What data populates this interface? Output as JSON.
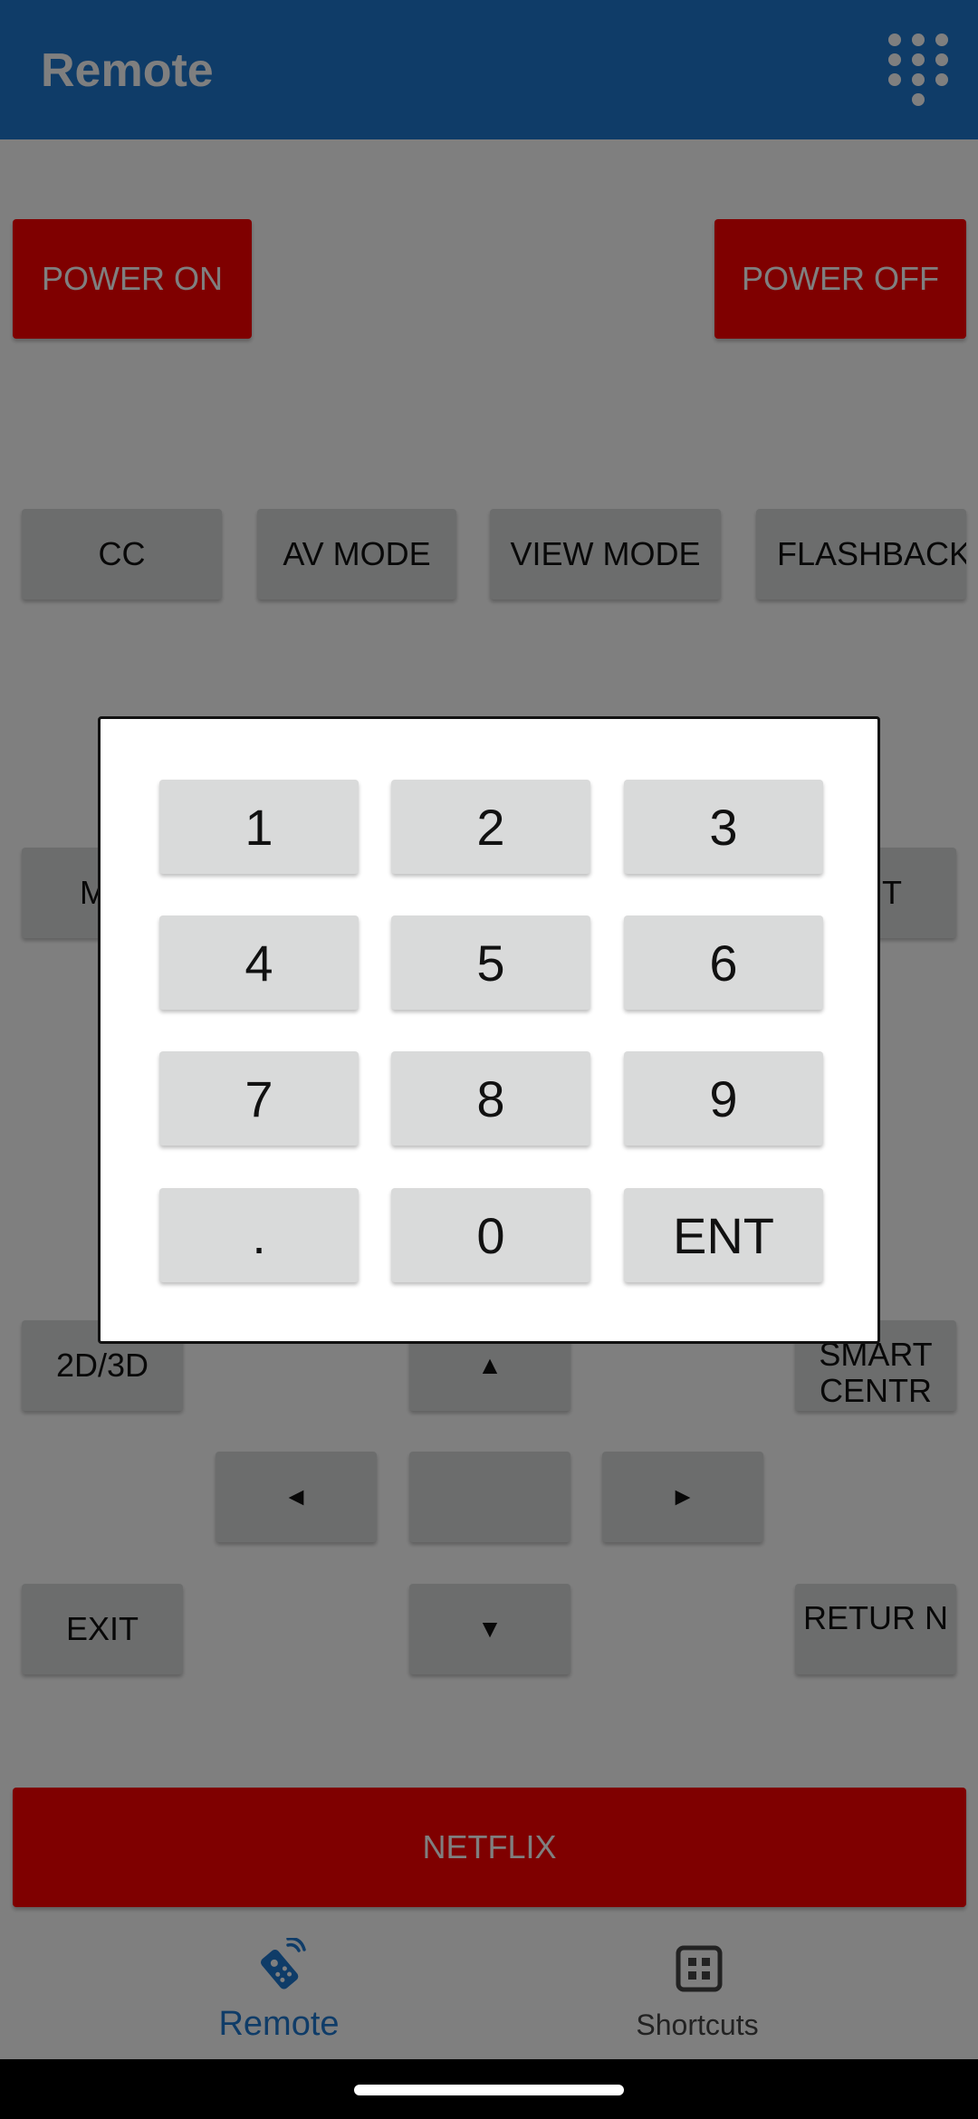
{
  "app_bar": {
    "title": "Remote",
    "background": "#1F78D1",
    "dialpad_icon": "dialpad-icon"
  },
  "remote": {
    "power_on": "POWER ON",
    "power_off": "POWER OFF",
    "row_modes": [
      "CC",
      "AV MODE",
      "VIEW MODE",
      "FLASHBACK"
    ],
    "row_partial_left": "M",
    "row_partial_right": "T",
    "btn_2d3d": "2D/3D",
    "btn_up": "▲",
    "btn_smart_centre": "SMART CENTR",
    "btn_left": "◄",
    "btn_ok": "",
    "btn_right": "►",
    "btn_exit": "EXIT",
    "btn_down": "▼",
    "btn_return": "RETUR N",
    "netflix": "NETFLIX"
  },
  "keypad": {
    "keys": [
      "1",
      "2",
      "3",
      "4",
      "5",
      "6",
      "7",
      "8",
      "9",
      ".",
      "0",
      "ENT"
    ]
  },
  "bottom_nav": {
    "items": [
      {
        "label": "Remote",
        "icon": "remote-icon",
        "selected": true
      },
      {
        "label": "Shortcuts",
        "icon": "grid-icon",
        "selected": false
      }
    ]
  },
  "colors": {
    "primary": "#1F78D1",
    "red_button": "#FF0000",
    "grey_button": "#D9DADA",
    "nav_inactive": "#444444"
  }
}
